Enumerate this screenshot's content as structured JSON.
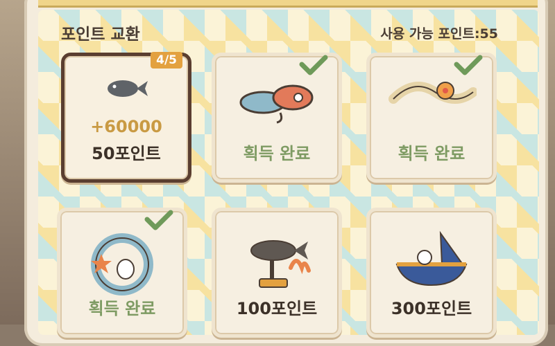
{
  "header": {
    "title": "포인트 교환",
    "points_label": "사용 가능 포인트:55"
  },
  "cards": [
    {
      "badge": "4/5",
      "amount": "+60000",
      "label": "50포인트",
      "icon": "fish-icon"
    },
    {
      "label": "획득 완료",
      "icon": "fishing-lure-icon"
    },
    {
      "label": "획득 완료",
      "icon": "ribbon-flower-icon"
    },
    {
      "label": "획득 완료",
      "icon": "wreath-icon"
    },
    {
      "label": "100포인트",
      "icon": "fish-trophy-icon"
    },
    {
      "label": "300포인트",
      "icon": "boat-icon"
    }
  ],
  "colors": {
    "done": "#7e9b63",
    "badge": "#e3a13f",
    "check": "#6f9a5a"
  }
}
